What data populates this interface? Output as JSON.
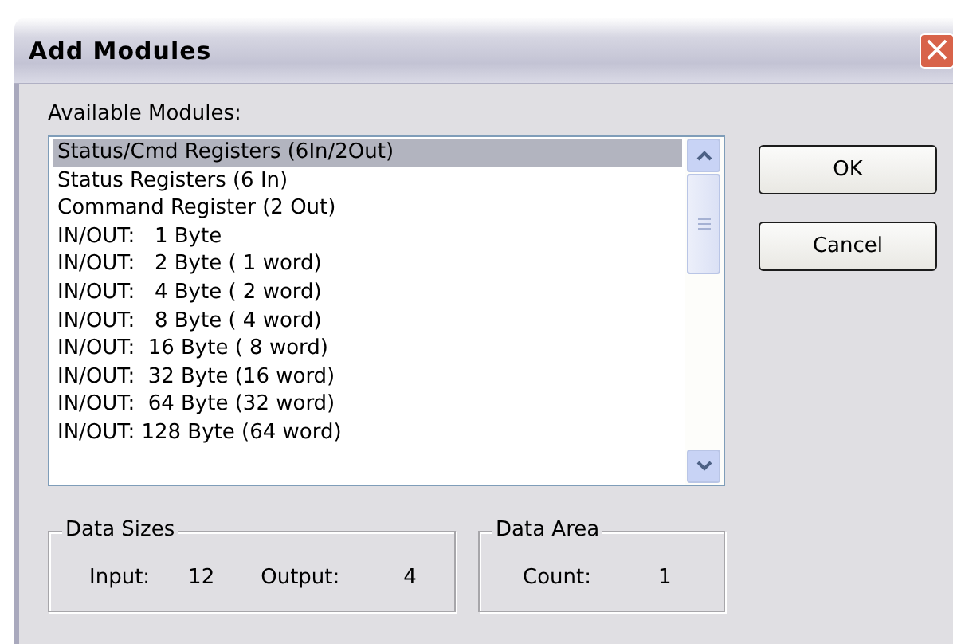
{
  "window": {
    "title": "Add Modules",
    "close_button": "×"
  },
  "list_label": "Available Modules:",
  "modules": [
    {
      "label": "Status/Cmd Registers (6In/2Out)",
      "selected": true
    },
    {
      "label": "Status Registers (6 In)",
      "selected": false
    },
    {
      "label": "Command Register (2 Out)",
      "selected": false
    },
    {
      "label": "IN/OUT:   1 Byte",
      "selected": false
    },
    {
      "label": "IN/OUT:   2 Byte ( 1 word)",
      "selected": false
    },
    {
      "label": "IN/OUT:   4 Byte ( 2 word)",
      "selected": false
    },
    {
      "label": "IN/OUT:   8 Byte ( 4 word)",
      "selected": false
    },
    {
      "label": "IN/OUT:  16 Byte ( 8 word)",
      "selected": false
    },
    {
      "label": "IN/OUT:  32 Byte (16 word)",
      "selected": false
    },
    {
      "label": "IN/OUT:  64 Byte (32 word)",
      "selected": false
    },
    {
      "label": "IN/OUT: 128 Byte (64 word)",
      "selected": false
    }
  ],
  "buttons": [
    "OK",
    "Cancel"
  ],
  "data_sizes": {
    "title": "Data Sizes",
    "input_label": "Input:",
    "input_value": "12",
    "output_label": "Output:",
    "output_value": "4"
  },
  "data_area": {
    "title": "Data Area",
    "count_label": "Count:",
    "count_value": "1"
  }
}
